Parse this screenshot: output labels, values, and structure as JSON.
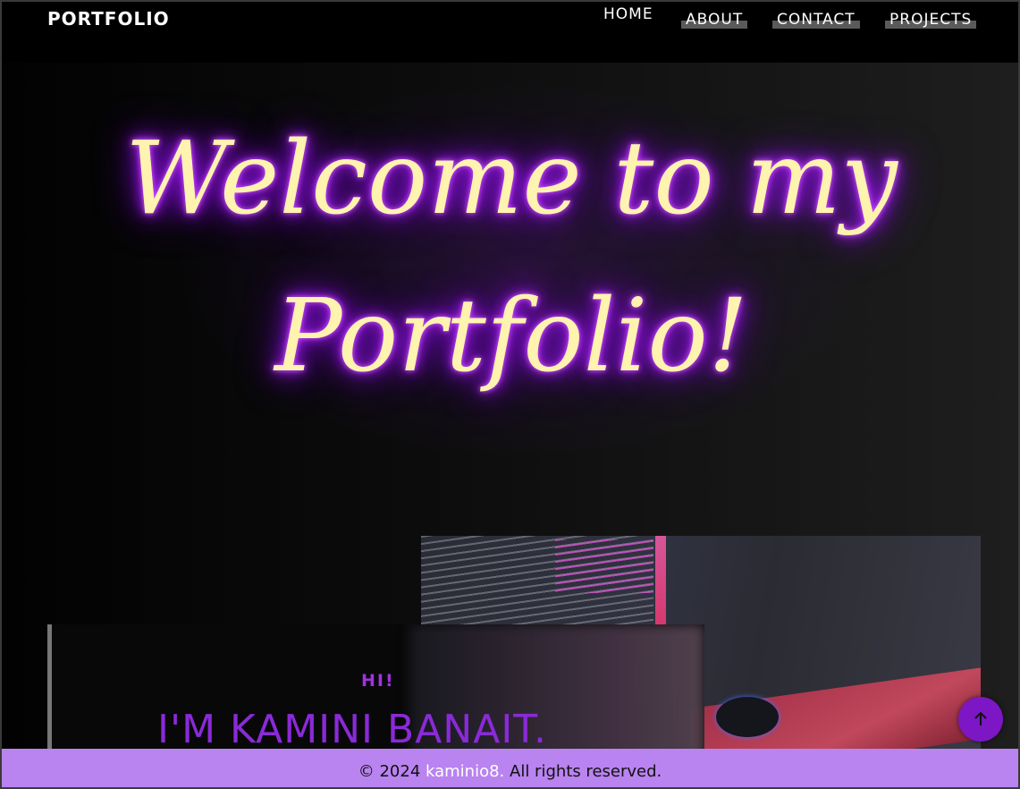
{
  "navbar": {
    "brand": "PORTFOLIO",
    "links": [
      {
        "label": "HOME"
      },
      {
        "label": "ABOUT"
      },
      {
        "label": "CONTACT"
      },
      {
        "label": "PROJECTS"
      }
    ]
  },
  "hero": {
    "title_line1": "Welcome to my",
    "title_line2": "Portfolio!"
  },
  "intro": {
    "greeting": "HI!",
    "name": "I'M KAMINI BANAIT."
  },
  "footer": {
    "prefix": "© 2024 ",
    "link_text": "kaminio8.",
    "suffix": " All rights reserved."
  },
  "scroll_top": {
    "icon": "arrow-up-icon"
  },
  "colors": {
    "accent": "#7d16c4",
    "footer_bg": "#b983f0",
    "neon_text": "#fff3b0",
    "neon_glow": "#b021ff"
  }
}
